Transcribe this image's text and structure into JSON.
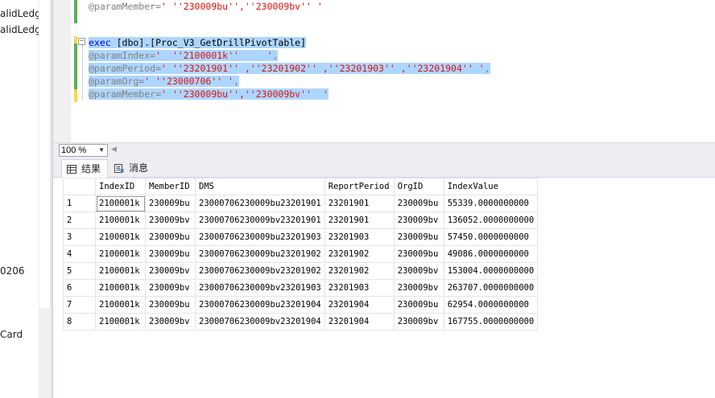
{
  "object_explorer": {
    "items": [
      "alidLedg",
      "alidLedg",
      "0206",
      "Card"
    ]
  },
  "editor": {
    "lines": [
      {
        "segments": [
          {
            "text": "@paramMember=",
            "cls": "gray"
          },
          {
            "text": "' ''230009bu'',''230009bv'' '",
            "cls": "str"
          }
        ],
        "selected": false
      },
      {
        "segments": [],
        "selected": false
      },
      {
        "segments": [
          {
            "text": "exec",
            "cls": "kw"
          },
          {
            "text": " [dbo].[Proc_V3_GetDrillPivotTable]",
            "cls": "plain"
          }
        ],
        "selected": true
      },
      {
        "segments": [
          {
            "text": "@paramIndex=",
            "cls": "gray"
          },
          {
            "text": "'  ''2100001k''     '",
            "cls": "str"
          },
          {
            "text": ",",
            "cls": "gray"
          }
        ],
        "selected": true
      },
      {
        "segments": [
          {
            "text": "@paramPeriod=",
            "cls": "gray"
          },
          {
            "text": "' ''23201901'' ,''23201902'' ,''23201903'' ,''23201904'' '",
            "cls": "str"
          },
          {
            "text": ",",
            "cls": "gray"
          }
        ],
        "selected": true
      },
      {
        "segments": [
          {
            "text": "@paramOrg=",
            "cls": "gray"
          },
          {
            "text": "' ''23000706'' '",
            "cls": "str"
          },
          {
            "text": ",",
            "cls": "gray"
          }
        ],
        "selected": true
      },
      {
        "segments": [
          {
            "text": "@paramMember=",
            "cls": "gray"
          },
          {
            "text": "' ''230009bu'',''230009bv''  '",
            "cls": "str"
          }
        ],
        "selected": true
      }
    ]
  },
  "zoom": {
    "value": "100 %"
  },
  "tabs": {
    "results_label": "结果",
    "messages_label": "消息"
  },
  "grid": {
    "columns": [
      "",
      "IndexID",
      "MemberID",
      "DMS",
      "ReportPeriod",
      "OrgID",
      "IndexValue"
    ],
    "rows": [
      [
        "1",
        "2100001k",
        "230009bu",
        "23000706230009bu23201901",
        "23201901",
        "230009bu",
        "55339.0000000000"
      ],
      [
        "2",
        "2100001k",
        "230009bv",
        "23000706230009bv23201901",
        "23201901",
        "230009bv",
        "136052.0000000000"
      ],
      [
        "3",
        "2100001k",
        "230009bu",
        "23000706230009bu23201903",
        "23201903",
        "230009bu",
        "57450.0000000000"
      ],
      [
        "4",
        "2100001k",
        "230009bu",
        "23000706230009bu23201902",
        "23201902",
        "230009bu",
        "49086.0000000000"
      ],
      [
        "5",
        "2100001k",
        "230009bv",
        "23000706230009bv23201902",
        "23201902",
        "230009bv",
        "153004.0000000000"
      ],
      [
        "6",
        "2100001k",
        "230009bv",
        "23000706230009bv23201903",
        "23201903",
        "230009bv",
        "263707.0000000000"
      ],
      [
        "7",
        "2100001k",
        "230009bu",
        "23000706230009bu23201904",
        "23201904",
        "230009bu",
        "62954.0000000000"
      ],
      [
        "8",
        "2100001k",
        "230009bv",
        "23000706230009bv23201904",
        "23201904",
        "230009bv",
        "167755.0000000000"
      ]
    ]
  }
}
